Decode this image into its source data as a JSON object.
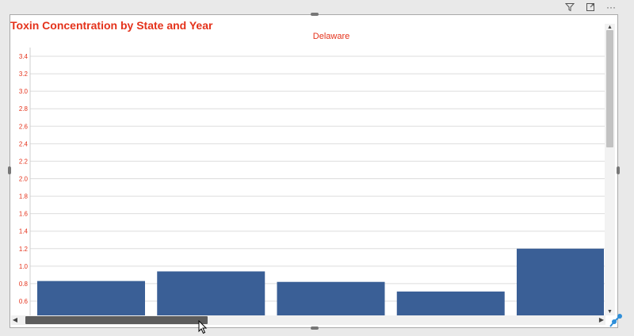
{
  "toolbar": {
    "icons": [
      "filter-icon",
      "focus-mode-icon",
      "more-options-icon"
    ],
    "more_glyph": "···"
  },
  "chart_data": {
    "type": "bar",
    "title": "Toxin Concentration by State and Year",
    "subtitle": "Delaware",
    "ylabel": "",
    "ylim": [
      0.5,
      3.5
    ],
    "yticks": [
      "3.4",
      "3.2",
      "3.0",
      "2.8",
      "2.6",
      "2.4",
      "2.2",
      "2.0",
      "1.8",
      "1.6",
      "1.4",
      "1.2",
      "1.0",
      "0.8",
      "0.6"
    ],
    "categories": [
      "",
      "",
      "",
      "",
      ""
    ],
    "values": [
      0.83,
      0.94,
      0.82,
      0.71,
      1.2
    ],
    "grid": true,
    "colors": {
      "bar": "#3a5f96",
      "text": "#e4321b",
      "grid": "#dddddd"
    }
  }
}
